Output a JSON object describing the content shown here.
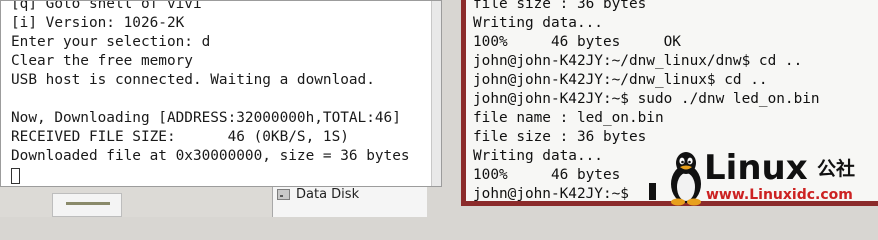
{
  "left_terminal": {
    "lines": [
      "[q] Goto shell of vivi",
      "[i] Version: 1026-2K",
      "Enter your selection: d",
      "Clear the free memory",
      "USB host is connected. Waiting a download.",
      "",
      "Now, Downloading [ADDRESS:32000000h,TOTAL:46]",
      "RECEIVED FILE SIZE:      46 (0KB/S, 1S)",
      "Downloaded file at 0x30000000, size = 36 bytes"
    ]
  },
  "right_terminal": {
    "lines": [
      "file size : 36 bytes",
      "Writing data...",
      "100%     46 bytes     OK",
      "john@john-K42JY:~/dnw_linux/dnw$ cd ..",
      "john@john-K42JY:~/dnw_linux$ cd ..",
      "john@john-K42JY:~$ sudo ./dnw led_on.bin",
      "file name : led_on.bin",
      "file size : 36 bytes",
      "Writing data...",
      "100%     46 bytes",
      "john@john-K42JY:~$ "
    ]
  },
  "file_manager": {
    "item_label": "Data Disk",
    "item_icon": "drive-icon"
  },
  "watermark": {
    "word": "Linux",
    "cjk": "公社",
    "url": "www.Linuxidc.com",
    "icon": "tux-penguin-icon"
  },
  "colors": {
    "right_terminal_frame": "#8b2b2b",
    "watermark_url": "#cc2222"
  }
}
